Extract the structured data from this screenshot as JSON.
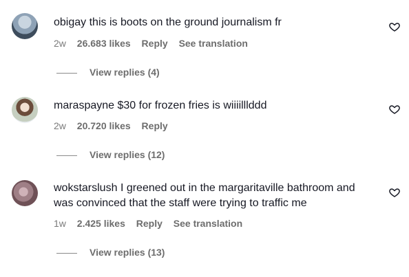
{
  "comments": [
    {
      "username": "obigay",
      "text": "this is boots on the ground journalism fr",
      "time": "2w",
      "likes": "26.683 likes",
      "reply": "Reply",
      "translate": "See translation",
      "view_replies": "View replies (4)"
    },
    {
      "username": "maraspayne",
      "text": "$30 for frozen fries is wiiiilllddd",
      "time": "2w",
      "likes": "20.720 likes",
      "reply": "Reply",
      "view_replies": "View replies (12)"
    },
    {
      "username": "wokstarslush",
      "text": "I greened out in the margaritaville bathroom and was convinced that the staff were trying to traffic me",
      "time": "1w",
      "likes": "2.425 likes",
      "reply": "Reply",
      "translate": "See translation",
      "view_replies": "View replies (13)"
    }
  ],
  "icons": {
    "like": "heart-outline-icon"
  }
}
